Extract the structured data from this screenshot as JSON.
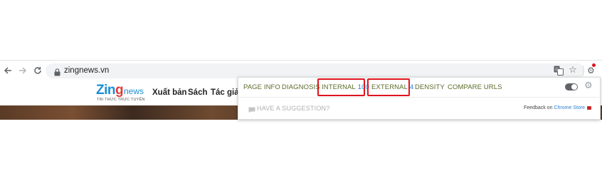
{
  "browser": {
    "url": "zingnews.vn",
    "icons": {
      "back": "back-arrow-icon",
      "forward": "forward-arrow-icon",
      "reload": "reload-icon",
      "lock": "lock-icon",
      "translate": "translate-icon",
      "bookmark": "star-icon",
      "extension": "gear-icon"
    }
  },
  "site": {
    "logo_main_1": "Zin",
    "logo_main_2": "g",
    "logo_sub": "news",
    "logo_tagline": "TRI THỨC TRỰC TUYẾN",
    "nav": [
      "Xuất bản",
      "Sách",
      "Tác giả"
    ]
  },
  "popup": {
    "tabs": [
      {
        "label": "PAGE INFO"
      },
      {
        "label": "DIAGNOSIS"
      },
      {
        "label": "INTERNAL",
        "count": "100",
        "highlighted": true
      },
      {
        "label": "EXTERNAL",
        "count": "4",
        "highlighted": true
      },
      {
        "label": "DENSITY"
      },
      {
        "label": "COMPARE URLS"
      }
    ],
    "suggestion": "HAVE A SUGGESTION?",
    "feedback_prefix": "Feedback on",
    "feedback_link": "Chrome Store",
    "colors": {
      "tab_text": "#5b6b2a",
      "count": "#2a7fd4",
      "highlight": "#e0141e"
    }
  }
}
